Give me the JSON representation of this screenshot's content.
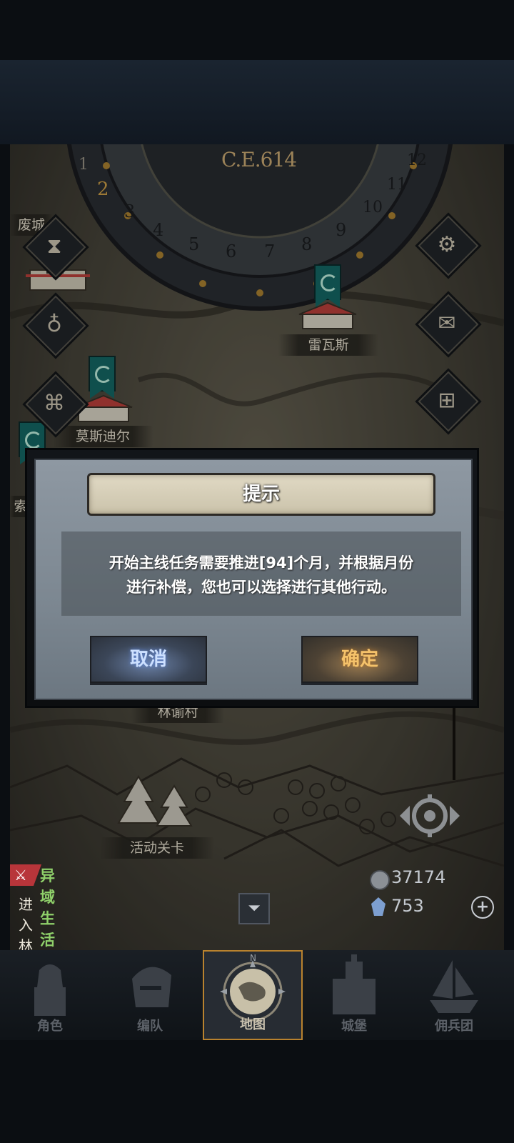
{
  "map": {
    "era": "C.E.614",
    "wheel_numbers": [
      "1",
      "2",
      "3",
      "4",
      "5",
      "6",
      "7",
      "8",
      "9",
      "10",
      "11",
      "12"
    ],
    "places": {
      "fort_partial": "废城",
      "leiwasi": "雷瓦斯",
      "mosidier": "莫斯迪尔",
      "linyu": "林谕村",
      "event_stage": "活动关卡",
      "cut_left": "索"
    }
  },
  "side_buttons": {
    "hourglass": "hourglass-icon",
    "bag": "bag-icon",
    "scroll": "scroll-icon",
    "settings": "gear-icon",
    "mail": "mail-icon",
    "grid": "grid-icon"
  },
  "dialog": {
    "title": "提示",
    "message_line1": "开始主线任务需要推进[94]个月，并根据月份",
    "message_line2": "进行补偿，您也可以选择进行其他行动。",
    "cancel_label": "取消",
    "confirm_label": "确定"
  },
  "quest": {
    "title": "异域生活",
    "subtitle": "进入林谕村"
  },
  "resources": {
    "coins": "37174",
    "crystals": "753"
  },
  "nav": {
    "items": [
      {
        "label": "角色"
      },
      {
        "label": "编队"
      },
      {
        "label": "地图"
      },
      {
        "label": "城堡"
      },
      {
        "label": "佣兵团"
      }
    ],
    "compass_letter": "N"
  },
  "colors": {
    "accent_gold": "#b9822e",
    "quest_green": "#8fd06a",
    "banner_teal": "#166e6b"
  }
}
